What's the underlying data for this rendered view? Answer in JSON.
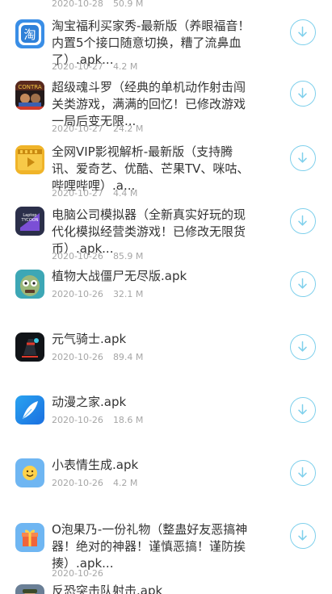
{
  "top_meta": {
    "date": "2020-10-28",
    "size": "50.9 M"
  },
  "items": [
    {
      "title": "淘宝福利买家秀-最新版（养眼福音！内置5个接口随意切换，糟了流鼻血了）.apk...",
      "date": "2020-10-27",
      "size": "4.2 M",
      "icon": "taobao-icon"
    },
    {
      "title": "超级魂斗罗（经典的单机动作射击闯关类游戏，满满的回忆！已修改游戏一局后变无限...",
      "date": "2020-10-27",
      "size": "24.2 M",
      "icon": "contra-icon"
    },
    {
      "title": "全网VIP影视解析-最新版（支持腾讯、爱奇艺、优酷、芒果TV、咪咕、哔哩哔哩）.a...",
      "date": "2020-10-27",
      "size": "4.4 M",
      "icon": "video-player-icon"
    },
    {
      "title": "电脑公司模拟器（全新真实好玩的现代化模拟经营类游戏！已修改无限货币）.apk...",
      "date": "2020-10-26",
      "size": "85.9 M",
      "icon": "laptop-tycoon-icon"
    },
    {
      "title": "植物大战僵尸无尽版.apk",
      "date": "2020-10-26",
      "size": "32.1 M",
      "icon": "zombie-icon"
    },
    {
      "title": "元气骑士.apk",
      "date": "2020-10-26",
      "size": "89.4 M",
      "icon": "soul-knight-icon"
    },
    {
      "title": "动漫之家.apk",
      "date": "2020-10-26",
      "size": "18.6 M",
      "icon": "feather-icon"
    },
    {
      "title": "小表情生成.apk",
      "date": "2020-10-26",
      "size": "4.2 M",
      "icon": "emoji-icon"
    },
    {
      "title": "O泡果乃-一份礼物（整蛊好友恶搞神器！绝对的神器！谨慎恶搞！谨防挨揍）.apk...",
      "date": "2020-10-26",
      "size": "",
      "icon": "gift-icon"
    },
    {
      "title": "反恐突击队射击.apk",
      "date": "",
      "size": "",
      "icon": "soldier-icon"
    }
  ],
  "colors": {
    "accent": "#7fd0ec",
    "title": "#333333",
    "meta": "#a6a6a6"
  },
  "download_icon": "download-arrow-icon"
}
